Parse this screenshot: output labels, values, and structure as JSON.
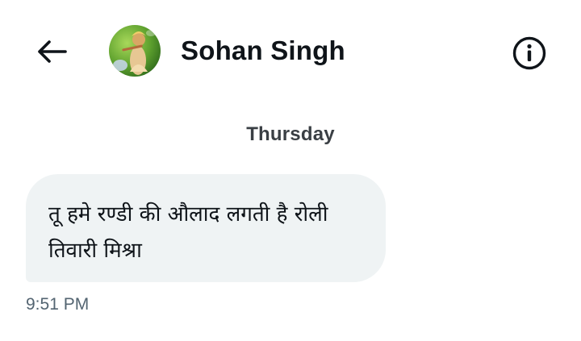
{
  "header": {
    "back_icon": "arrow-left-icon",
    "contact_name": "Sohan Singh",
    "avatar": "contact-avatar",
    "info_icon": "info-icon"
  },
  "conversation": {
    "day_label": "Thursday",
    "messages": [
      {
        "text": "तू हमे रण्डी की औलाद लगती है रोली तिवारी मिश्रा",
        "time": "9:51 PM",
        "direction": "incoming"
      }
    ]
  },
  "colors": {
    "text_primary": "#0f1419",
    "text_secondary": "#536471",
    "bubble_bg": "#eff3f4",
    "background": "#ffffff"
  }
}
